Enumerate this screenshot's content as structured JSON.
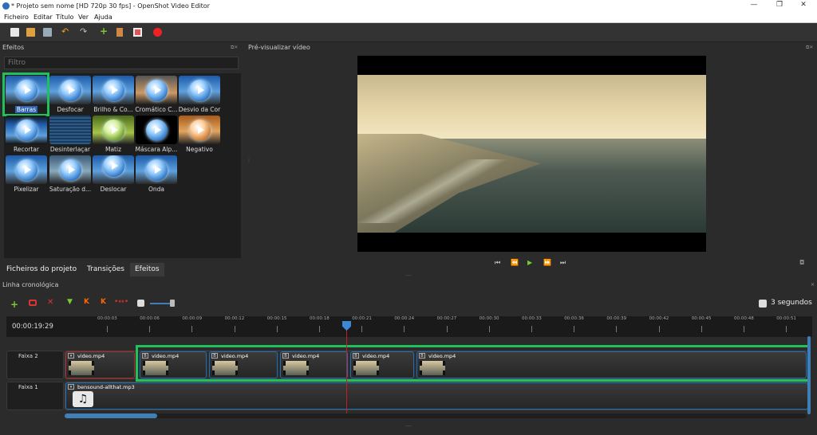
{
  "window": {
    "title": "* Projeto sem nome [HD 720p 30 fps] - OpenShot Video Editor",
    "controls": [
      "—",
      "❐",
      "✕"
    ]
  },
  "menu": [
    "Ficheiro",
    "Editar",
    "Título",
    "Ver",
    "Ajuda"
  ],
  "toolbar": {
    "icons": [
      "new-project-icon",
      "open-project-icon",
      "save-project-icon",
      "undo-icon",
      "redo-icon",
      "import-files-icon",
      "profile-icon",
      "fullscreen-icon",
      "export-video-icon"
    ]
  },
  "effects": {
    "title": "Efeitos",
    "filter_placeholder": "Filtro",
    "items": [
      {
        "label": "Barras",
        "selected": true
      },
      {
        "label": "Desfocar"
      },
      {
        "label": "Brilho & Co..."
      },
      {
        "label": "Cromático C..."
      },
      {
        "label": "Desvio da Cor"
      },
      {
        "label": "Recortar"
      },
      {
        "label": "Desinterlaçar"
      },
      {
        "label": "Matiz"
      },
      {
        "label": "Máscara Alp..."
      },
      {
        "label": "Negativo"
      },
      {
        "label": "Pixelizar"
      },
      {
        "label": "Saturação d..."
      },
      {
        "label": "Deslocar"
      },
      {
        "label": "Onda"
      }
    ]
  },
  "tabs": [
    "Ficheiros do projeto",
    "Transições",
    "Efeitos"
  ],
  "preview": {
    "title": "Pré-visualizar vídeo",
    "buttons": [
      "⏮",
      "⏪",
      "▶",
      "⏩",
      "⏭"
    ]
  },
  "timeline": {
    "title": "Linha cronológica",
    "zoom_label": "3 segundos",
    "timecode": "00:00:19:29",
    "ticks": [
      "00:00:03",
      "00:00:06",
      "00:00:09",
      "00:00:12",
      "00:00:15",
      "00:00:18",
      "00:00:21",
      "00:00:24",
      "00:00:27",
      "00:00:30",
      "00:00:33",
      "00:00:36",
      "00:00:39",
      "00:00:42",
      "00:00:45",
      "00:00:48",
      "00:00:51"
    ],
    "tracks": [
      {
        "name": "Faixa 2",
        "clips": [
          "video.mp4",
          "video.mp4",
          "video.mp4",
          "video.mp4",
          "video.mp4",
          "video.mp4"
        ]
      },
      {
        "name": "Faixa 1",
        "clips": [
          "bensound-allthat.mp3"
        ]
      }
    ]
  },
  "colors": {
    "accent": "#2f62b3",
    "highlight": "#20c05a",
    "playhead": "#c02020"
  }
}
